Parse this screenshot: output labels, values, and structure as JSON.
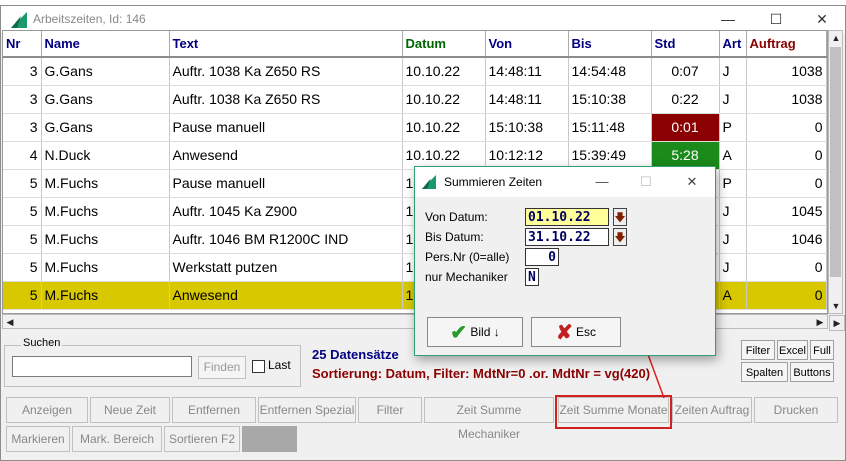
{
  "window": {
    "title": "Arbeitszeiten, Id: 146"
  },
  "columns": [
    "Nr",
    "Name",
    "Text",
    "Datum",
    "Von",
    "Bis",
    "Std",
    "Art",
    "Auftrag"
  ],
  "rows": [
    {
      "nr": "3",
      "name": "G.Gans",
      "text": "Auftr.  1038 Ka Z650 RS",
      "datum": "10.10.22",
      "von": "14:48:11",
      "bis": "14:54:48",
      "std": "0:07",
      "art": "J",
      "auftrag": "1038",
      "std_bg": "#ffffff",
      "std_fg": "#000000",
      "selected": false
    },
    {
      "nr": "3",
      "name": "G.Gans",
      "text": "Auftr.  1038 Ka Z650 RS",
      "datum": "10.10.22",
      "von": "14:48:11",
      "bis": "15:10:38",
      "std": "0:22",
      "art": "J",
      "auftrag": "1038",
      "std_bg": "#ffffff",
      "std_fg": "#000000",
      "selected": false
    },
    {
      "nr": "3",
      "name": "G.Gans",
      "text": "Pause manuell",
      "datum": "10.10.22",
      "von": "15:10:38",
      "bis": "15:11:48",
      "std": "0:01",
      "art": "P",
      "auftrag": "0",
      "std_bg": "#8b0000",
      "std_fg": "#ffffff",
      "selected": false
    },
    {
      "nr": "4",
      "name": "N.Duck",
      "text": "Anwesend",
      "datum": "10.10.22",
      "von": "10:12:12",
      "bis": "15:39:49",
      "std": "5:28",
      "art": "A",
      "auftrag": "0",
      "std_bg": "#1a8a1a",
      "std_fg": "#ffffff",
      "selected": false
    },
    {
      "nr": "5",
      "name": "M.Fuchs",
      "text": "Pause manuell",
      "datum": "1",
      "von": "",
      "bis": "",
      "std": "",
      "art": "P",
      "auftrag": "0",
      "std_bg": "#ffffff",
      "std_fg": "#000000",
      "selected": false
    },
    {
      "nr": "5",
      "name": "M.Fuchs",
      "text": "Auftr.  1045 Ka Z900",
      "datum": "1",
      "von": "",
      "bis": "",
      "std": "",
      "art": "J",
      "auftrag": "1045",
      "std_bg": "#ffffff",
      "std_fg": "#000000",
      "selected": false
    },
    {
      "nr": "5",
      "name": "M.Fuchs",
      "text": "Auftr.  1046 BM R1200C IND",
      "datum": "1",
      "von": "",
      "bis": "",
      "std": "",
      "art": "J",
      "auftrag": "1046",
      "std_bg": "#ffffff",
      "std_fg": "#000000",
      "selected": false
    },
    {
      "nr": "5",
      "name": "M.Fuchs",
      "text": "Werkstatt putzen",
      "datum": "1",
      "von": "",
      "bis": "",
      "std": "",
      "art": "J",
      "auftrag": "0",
      "std_bg": "#ffffff",
      "std_fg": "#000000",
      "selected": false
    },
    {
      "nr": "5",
      "name": "M.Fuchs",
      "text": "Anwesend",
      "datum": "1",
      "von": "",
      "bis": "",
      "std": "",
      "art": "A",
      "auftrag": "0",
      "std_bg": "#d7c800",
      "std_fg": "#000000",
      "selected": true
    }
  ],
  "search": {
    "label": "Suchen",
    "value": "",
    "find_button": "Finden",
    "last_label": "Last"
  },
  "status": {
    "count": "25 Datensätze",
    "sort": "Sortierung: Datum, Filter: MdtNr=0 .or. MdtNr = vg(420)"
  },
  "side_buttons": [
    "Filter",
    "Excel",
    "Full",
    "Spalten",
    "Buttons"
  ],
  "buttons_row1": [
    "Anzeigen",
    "Neue Zeit",
    "Entfernen",
    "Entfernen Spezial",
    "Filter",
    "Zeit Summe Mechaniker",
    "Zeit Summe Monate",
    "Zeiten Auftrag",
    "Drucken"
  ],
  "buttons_row2": [
    "Markieren",
    "Mark. Bereich",
    "Sortieren F2"
  ],
  "dialog": {
    "title": "Summieren Zeiten",
    "von_label": "Von Datum:",
    "von_value": "01.10.22",
    "bis_label": "Bis Datum:",
    "bis_value": "31.10.22",
    "pers_label": "Pers.Nr (0=alle)",
    "pers_value": "0",
    "mech_label": "nur Mechaniker",
    "mech_value": "N",
    "bild_button": "Bild",
    "esc_button": "Esc"
  },
  "colors": {
    "accent": "#1a9a6a",
    "selected_row": "#d7c800",
    "highlight": "#d02020"
  }
}
